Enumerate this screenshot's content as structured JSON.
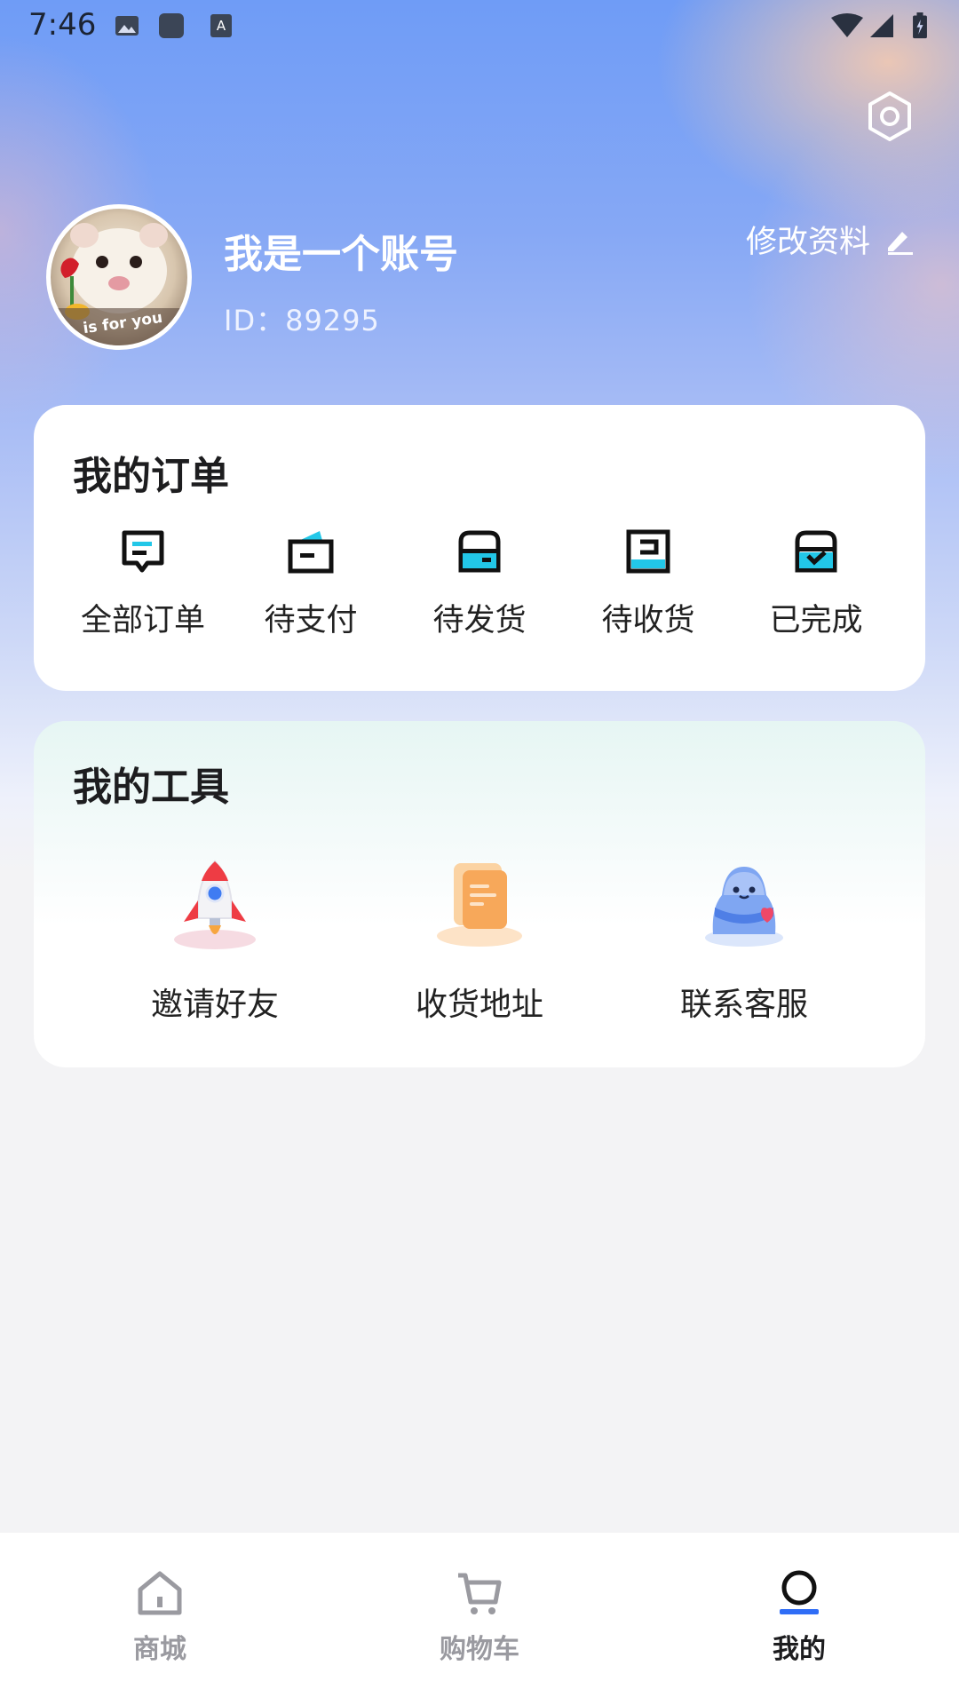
{
  "status_bar": {
    "time": "7:46"
  },
  "profile": {
    "name": "我是一个账号",
    "id_text": "ID：89295",
    "avatar_caption": "is for you",
    "edit_label": "修改资料"
  },
  "orders": {
    "title": "我的订单",
    "items": [
      {
        "label": "全部订单",
        "icon": "all-orders-icon"
      },
      {
        "label": "待支付",
        "icon": "pending-payment-icon"
      },
      {
        "label": "待发货",
        "icon": "pending-shipment-icon"
      },
      {
        "label": "待收货",
        "icon": "pending-receipt-icon"
      },
      {
        "label": "已完成",
        "icon": "completed-icon"
      }
    ]
  },
  "tools": {
    "title": "我的工具",
    "items": [
      {
        "label": "邀请好友",
        "icon": "rocket-icon"
      },
      {
        "label": "收货地址",
        "icon": "address-book-icon"
      },
      {
        "label": "联系客服",
        "icon": "support-mascot-icon"
      }
    ]
  },
  "tabbar": {
    "items": [
      {
        "label": "商城",
        "icon": "home-icon",
        "active": false
      },
      {
        "label": "购物车",
        "icon": "cart-icon",
        "active": false
      },
      {
        "label": "我的",
        "icon": "profile-icon",
        "active": true
      }
    ]
  },
  "colors": {
    "accent": "#2f6df6",
    "icon_cyan": "#22c7e8"
  }
}
